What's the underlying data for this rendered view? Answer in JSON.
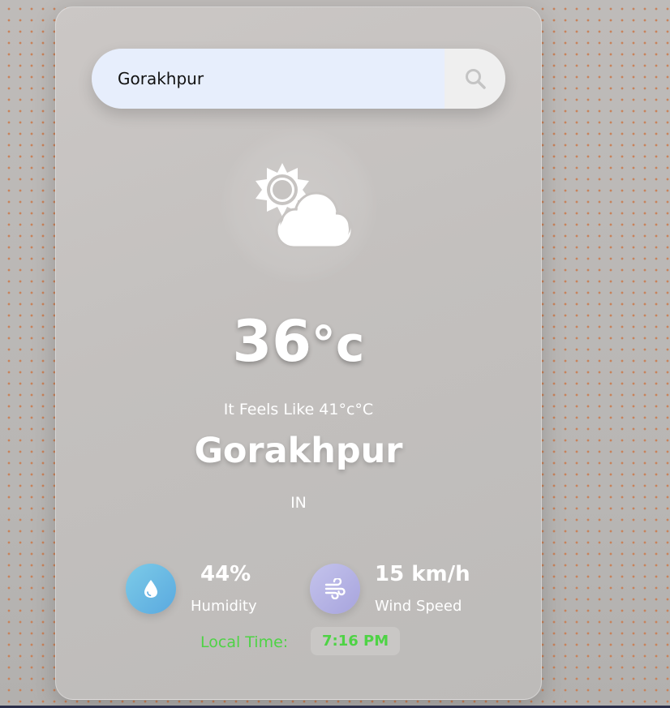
{
  "search": {
    "value": "Gorakhpur",
    "placeholder": ""
  },
  "weather": {
    "icon": "sun-behind-cloud-icon",
    "temperature": "36",
    "temperature_unit": "°c",
    "feels_like": "It Feels Like 41°c°C",
    "city": "Gorakhpur",
    "country": "IN"
  },
  "stats": {
    "humidity_value": "44%",
    "humidity_label": "Humidity",
    "humidity_icon": "water-drop-icon",
    "wind_value": "15 km/h",
    "wind_label": "Wind Speed",
    "wind_icon": "wind-icon"
  },
  "local_time": {
    "label": "Local Time:",
    "value": "7:16 PM"
  },
  "colors": {
    "accent_green": "#4ed345",
    "search_bg": "#e7eefc",
    "dot_pattern": "#c8825a"
  }
}
